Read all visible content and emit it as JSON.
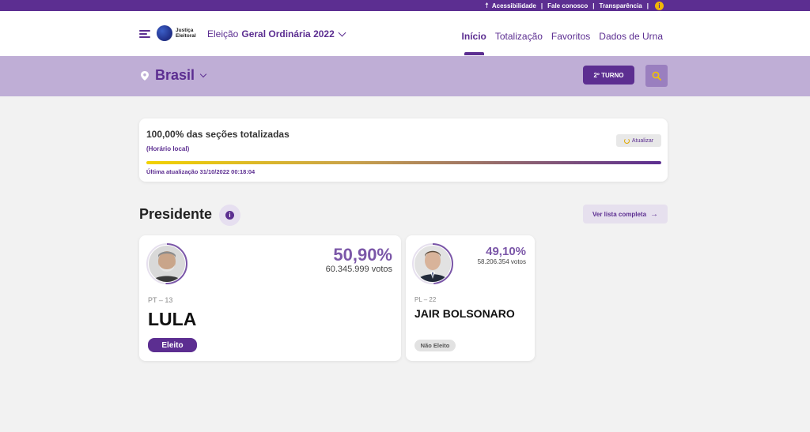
{
  "topbar": {
    "accessibility": "Acessibilidade",
    "contact": "Fale conosco",
    "transparency": "Transparência",
    "separator": "|",
    "info_glyph": "i"
  },
  "header": {
    "logo_line1": "Justiça",
    "logo_line2": "Eleitoral",
    "election_prefix": "Eleição",
    "election_name": "Geral Ordinária 2022",
    "nav": [
      {
        "label": "Início",
        "active": true
      },
      {
        "label": "Totalização",
        "active": false
      },
      {
        "label": "Favoritos",
        "active": false
      },
      {
        "label": "Dados de Urna",
        "active": false
      }
    ]
  },
  "location": {
    "name": "Brasil",
    "turno_label": "2º TURNO"
  },
  "status": {
    "title": "100,00% das seções totalizadas",
    "subtitle": "(Horário local)",
    "update_label": "Atualizar",
    "progress_percent": 100,
    "last_update": "Última atualização 31/10/2022 00:18:04"
  },
  "section": {
    "title": "Presidente",
    "info_glyph": "i",
    "list_label": "Ver lista completa",
    "list_arrow": "→"
  },
  "candidates": [
    {
      "party": "PT – 13",
      "name": "LULA",
      "percent": "50,90%",
      "votes": "60.345.999 votos",
      "status": "Eleito",
      "vote_fraction": 0.509
    },
    {
      "party": "PL – 22",
      "name": "JAIR BOLSONARO",
      "percent": "49,10%",
      "votes": "58.206.354 votos",
      "status": "Não Eleito",
      "vote_fraction": 0.491
    }
  ],
  "colors": {
    "brand_purple": "#5c2e91",
    "accent_purple": "#7b57a8",
    "location_bar": "#bfaed6",
    "gold": "#f2b705"
  },
  "icons": {
    "accessibility": "accessibility-icon",
    "info": "info-icon",
    "menu": "hamburger-menu-icon",
    "chevron": "chevron-down-icon",
    "location": "location-pin-icon",
    "search": "search-icon",
    "refresh": "refresh-icon",
    "arrow": "arrow-right-icon"
  }
}
